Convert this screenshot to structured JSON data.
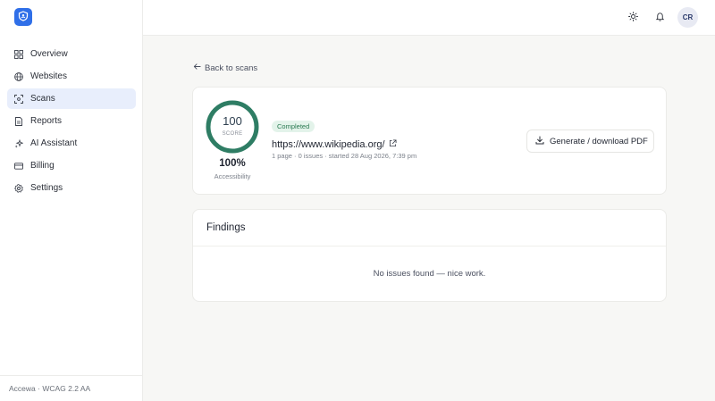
{
  "sidebar": {
    "logo_icon": "shield-icon",
    "items": [
      {
        "label": "Overview",
        "icon": "grid-icon",
        "active": false
      },
      {
        "label": "Websites",
        "icon": "globe-icon",
        "active": false
      },
      {
        "label": "Scans",
        "icon": "scan-icon",
        "active": true
      },
      {
        "label": "Reports",
        "icon": "document-icon",
        "active": false
      },
      {
        "label": "AI Assistant",
        "icon": "sparkle-icon",
        "active": false
      },
      {
        "label": "Billing",
        "icon": "credit-card-icon",
        "active": false
      },
      {
        "label": "Settings",
        "icon": "gear-icon",
        "active": false
      }
    ],
    "footer": "Accewa · WCAG 2.2 AA"
  },
  "topbar": {
    "theme_icon": "sun-icon",
    "notifications_icon": "bell-icon",
    "avatar_initials": "CR"
  },
  "main": {
    "back_label": "Back to scans",
    "scan": {
      "score": "100",
      "score_caption": "SCORE",
      "score_fraction": 1.0,
      "accessibility_percent": "100%",
      "accessibility_label": "Accessibility",
      "status": "Completed",
      "url": "https://www.wikipedia.org/",
      "meta": "1 page · 0 issues · started 28 Aug 2026, 7:39 pm",
      "pdf_button_label": "Generate / download PDF"
    },
    "findings": {
      "title": "Findings",
      "empty_message": "No issues found — nice work."
    }
  },
  "colors": {
    "accent": "#2f6fe8",
    "score_ring": "#2e7d64",
    "active_nav_bg": "#e8eefc",
    "badge_bg": "#e3f3ea",
    "badge_text": "#2a7a52"
  }
}
